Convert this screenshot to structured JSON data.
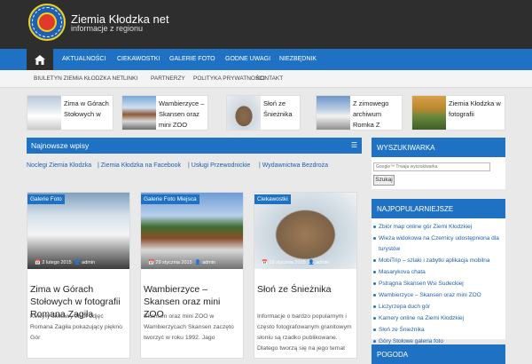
{
  "site": {
    "title": "Ziemia Kłodzka net",
    "description": "informacje z regionu"
  },
  "mainnav": {
    "items": [
      "AKTUALNOŚCI",
      "CIEKAWOSTKI",
      "GALERIE FOTO",
      "GODNE UWAGI",
      "NIEZBĘDNIK"
    ]
  },
  "subnav": {
    "items": [
      "BIULETYN ZIEMIA KŁODZKA NET",
      "LINKI",
      "PARTNERZY",
      "POLITYKA PRYWATNOŚCI",
      "KONTAKT"
    ]
  },
  "featured": [
    {
      "title": "Zima w Górach Stołowych w"
    },
    {
      "title": "Wambierzyce – Skansen oraz mini ZOO"
    },
    {
      "title": "Słoń ze Śnieżnika"
    },
    {
      "title": "Z zimowego archiwum Romka Z"
    },
    {
      "title": "Ziemia Kłodzka w fotografii"
    }
  ],
  "latest": {
    "heading": "Najnowsze wpisy",
    "icon": "list-icon"
  },
  "links": [
    "Noclegi Ziemia Kłodzka",
    "|  Ziemia  Kłodzka na Facebook",
    "|  Usługi Przewodnickie",
    "|  Wydawnictwa Bezdroża"
  ],
  "cards": [
    {
      "category": "Galerie Foto",
      "date": "2 lutego 2015",
      "author": "admin",
      "title": "Zima w Górach Stołowych w fotografii Romana Zagiła",
      "excerpt": "Kolejny ciekawy zbiór zdjęć Romana Zagiła pokazujący piękno Gór"
    },
    {
      "category": "Galerie Foto  Miejsca",
      "date": "29 stycznia 2015",
      "author": "admin",
      "title": "Wambierzyce – Skansen oraz mini ZOO",
      "excerpt": "Skansen oraz mini ZOO w Wambierzycach Skansen zaczęto tworzyć w roku 1992. Jago"
    },
    {
      "category": "Ciekawostki",
      "date": "19 stycznia 2015",
      "author": "admin",
      "title": "Słoń ze Śnieżnika",
      "excerpt": "Informacje o bardzo popularnym i często fotografowanym granitowym słoniu są rzadko publikowane. Dlatego tworzą się na jego temat"
    }
  ],
  "widgets": {
    "search": {
      "title": "WYSZUKIWARKA",
      "placeholder": "Google™ Trwaja wyszukiwarka",
      "button": "Szukaj"
    },
    "popular": {
      "title": "NAJPOPULARNIEJSZE",
      "items": [
        "Zbiór map online gór Ziemi Kłodzkiej",
        "Wieża widokowa na Czernicy udostępniona dla turystów",
        "MobiTrip – szlaki i zabytki aplikacja mobilna",
        "Masarykova chata",
        "Pstrągna Skansen Wsi Sudeckiej",
        "Wambierzyce – Skansen oraz mini ZOO",
        "Liczyrzepa duch gór",
        "Kamery online na Ziemi Kłodzkiej",
        "Słoń ze Śnieżnika",
        "Góry Stołowe galeria foto"
      ]
    },
    "weather": {
      "title": "POGODA"
    }
  },
  "colors": {
    "primary": "#1f72c3",
    "dark": "#2e2e2e"
  }
}
